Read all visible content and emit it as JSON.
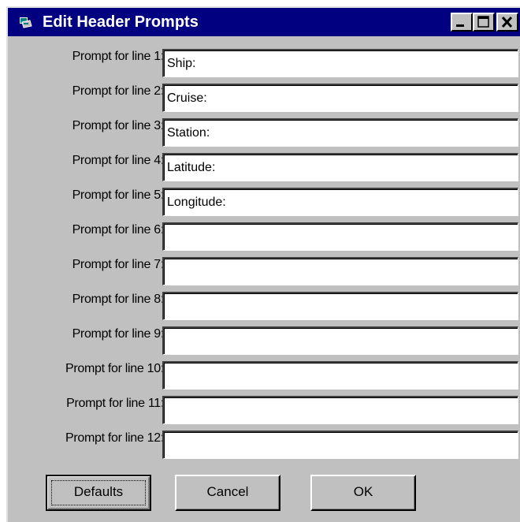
{
  "window": {
    "title": "Edit Header Prompts",
    "colors": {
      "titlebar": "#000080",
      "face": "#c0c0c0"
    }
  },
  "prompts": [
    {
      "label": "Prompt for line 1:",
      "value": "Ship:"
    },
    {
      "label": "Prompt for line 2:",
      "value": "Cruise:"
    },
    {
      "label": "Prompt for line 3:",
      "value": "Station:"
    },
    {
      "label": "Prompt for line 4:",
      "value": "Latitude:"
    },
    {
      "label": "Prompt for line 5:",
      "value": "Longitude:"
    },
    {
      "label": "Prompt for line 6:",
      "value": ""
    },
    {
      "label": "Prompt for line 7:",
      "value": ""
    },
    {
      "label": "Prompt for line 8:",
      "value": ""
    },
    {
      "label": "Prompt for line 9:",
      "value": ""
    },
    {
      "label": "Prompt for line 10:",
      "value": ""
    },
    {
      "label": "Prompt for line 11:",
      "value": ""
    },
    {
      "label": "Prompt for line 12:",
      "value": ""
    }
  ],
  "buttons": {
    "defaults": "Defaults",
    "cancel": "Cancel",
    "ok": "OK"
  }
}
